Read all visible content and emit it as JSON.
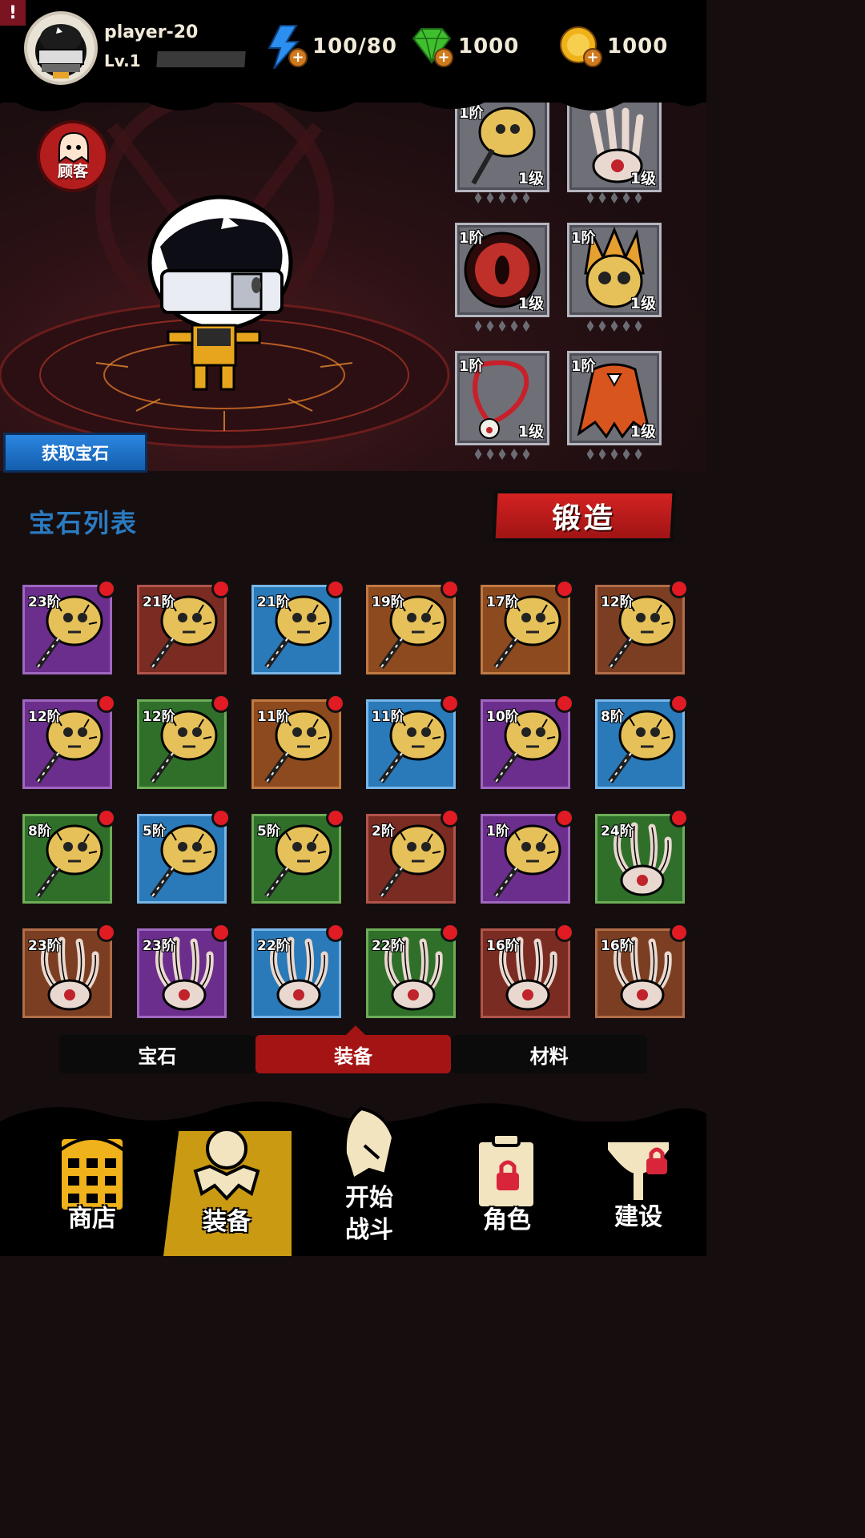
{
  "alert": "!",
  "player": {
    "name": "player-20",
    "level": "Lv.1"
  },
  "resources": [
    {
      "icon": "energy-bolt-icon",
      "value": "100/80"
    },
    {
      "icon": "gem-icon",
      "value": "1000"
    },
    {
      "icon": "gold-coin-icon",
      "value": "1000"
    }
  ],
  "customer_label": "顾客",
  "get_gem_label": "获取宝石",
  "section_title": "宝石列表",
  "forge_label": "锻造",
  "equipped": [
    {
      "tier": "1阶",
      "level": "1级",
      "item": "golden-skull-club"
    },
    {
      "tier": "",
      "level": "1级",
      "item": "bone-claw"
    },
    {
      "tier": "1阶",
      "level": "1级",
      "item": "red-eye-orb"
    },
    {
      "tier": "1阶",
      "level": "1级",
      "item": "flaming-skull"
    },
    {
      "tier": "1阶",
      "level": "1级",
      "item": "eyeball-necklace"
    },
    {
      "tier": "1阶",
      "level": "1级",
      "item": "demon-cape"
    }
  ],
  "inventory": [
    {
      "tier": "23阶",
      "color": "purple",
      "item": "club"
    },
    {
      "tier": "21阶",
      "color": "red",
      "item": "club"
    },
    {
      "tier": "21阶",
      "color": "blue",
      "item": "club"
    },
    {
      "tier": "19阶",
      "color": "orange",
      "item": "club"
    },
    {
      "tier": "17阶",
      "color": "orange",
      "item": "club"
    },
    {
      "tier": "12阶",
      "color": "brown",
      "item": "club"
    },
    {
      "tier": "12阶",
      "color": "purple",
      "item": "club"
    },
    {
      "tier": "12阶",
      "color": "green",
      "item": "club"
    },
    {
      "tier": "11阶",
      "color": "orange",
      "item": "club"
    },
    {
      "tier": "11阶",
      "color": "blue",
      "item": "club"
    },
    {
      "tier": "10阶",
      "color": "purple",
      "item": "club"
    },
    {
      "tier": "8阶",
      "color": "blue",
      "item": "club"
    },
    {
      "tier": "8阶",
      "color": "green",
      "item": "club"
    },
    {
      "tier": "5阶",
      "color": "blue",
      "item": "club"
    },
    {
      "tier": "5阶",
      "color": "green",
      "item": "club"
    },
    {
      "tier": "2阶",
      "color": "red",
      "item": "club"
    },
    {
      "tier": "1阶",
      "color": "purple",
      "item": "club"
    },
    {
      "tier": "24阶",
      "color": "green",
      "item": "claw"
    },
    {
      "tier": "23阶",
      "color": "brown",
      "item": "claw"
    },
    {
      "tier": "23阶",
      "color": "purple",
      "item": "claw"
    },
    {
      "tier": "22阶",
      "color": "blue",
      "item": "claw"
    },
    {
      "tier": "22阶",
      "color": "green",
      "item": "claw"
    },
    {
      "tier": "16阶",
      "color": "red",
      "item": "claw"
    },
    {
      "tier": "16阶",
      "color": "brown",
      "item": "claw"
    }
  ],
  "tabs": [
    {
      "label": "宝石",
      "active": false
    },
    {
      "label": "装备",
      "active": true
    },
    {
      "label": "材料",
      "active": false
    }
  ],
  "nav": [
    {
      "label": "商店",
      "icon": "shop-icon"
    },
    {
      "label": "装备",
      "icon": "equipment-icon",
      "active": true
    },
    {
      "label": "开始\n战斗",
      "icon": "battle-icon"
    },
    {
      "label": "角色",
      "icon": "character-locked-icon"
    },
    {
      "label": "建设",
      "icon": "build-locked-icon"
    }
  ],
  "colors": {
    "accent_red": "#a51414",
    "gem_title_blue": "#2a7bc0",
    "nav_active": "#c99a12",
    "notification_red": "#e01b24"
  }
}
